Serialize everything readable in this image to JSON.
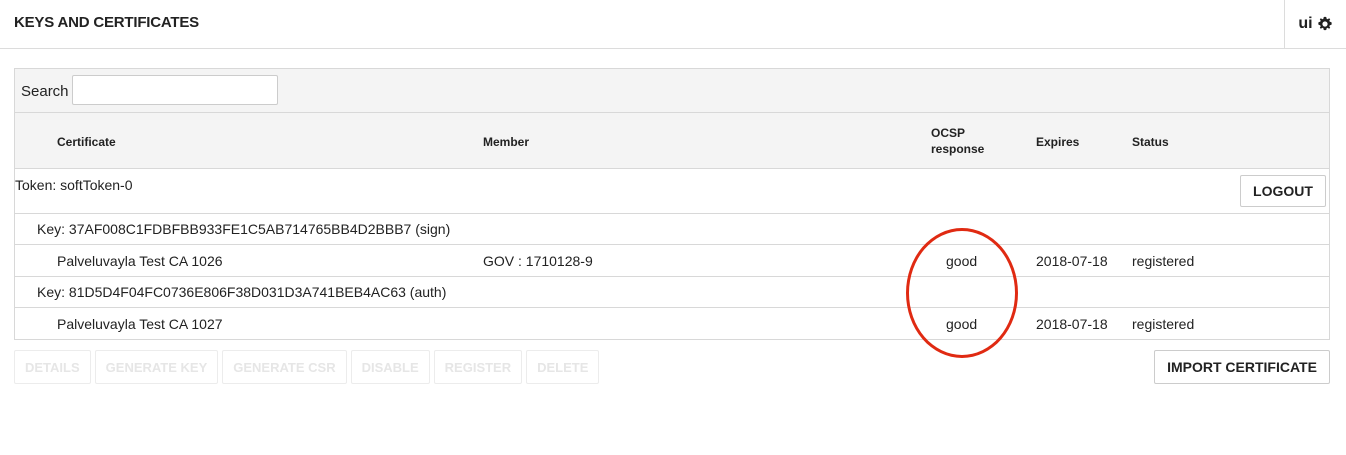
{
  "header": {
    "title": "KEYS AND CERTIFICATES",
    "user_label": "ui",
    "user_icon": "gear-icon"
  },
  "search": {
    "label": "Search",
    "value": "",
    "placeholder": ""
  },
  "table": {
    "columns": {
      "certificate": "Certificate",
      "member": "Member",
      "ocsp": "OCSP response",
      "expires": "Expires",
      "status": "Status"
    },
    "token": {
      "label": "Token: softToken-0",
      "logout_label": "LOGOUT"
    },
    "keys": [
      {
        "label": "Key: 37AF008C1FDBFBB933FE1C5AB714765BB4D2BBB7 (sign)",
        "certificates": [
          {
            "name": "Palveluvayla Test CA 1026",
            "member": "GOV : 1710128-9",
            "ocsp": "good",
            "expires": "2018-07-18",
            "status": "registered"
          }
        ]
      },
      {
        "label": "Key: 81D5D4F04FC0736E806F38D031D3A741BEB4AC63 (auth)",
        "certificates": [
          {
            "name": "Palveluvayla Test CA 1027",
            "member": "",
            "ocsp": "good",
            "expires": "2018-07-18",
            "status": "registered"
          }
        ]
      }
    ]
  },
  "actions": {
    "details": "DETAILS",
    "generate_key": "GENERATE KEY",
    "generate_csr": "GENERATE CSR",
    "disable": "DISABLE",
    "register": "REGISTER",
    "delete": "DELETE",
    "import_certificate": "IMPORT CERTIFICATE"
  },
  "colors": {
    "annotation": "#e02a12",
    "header_bg": "#f4f4f4",
    "border": "#d8d8d8",
    "disabled_text": "#e6e6e6"
  }
}
